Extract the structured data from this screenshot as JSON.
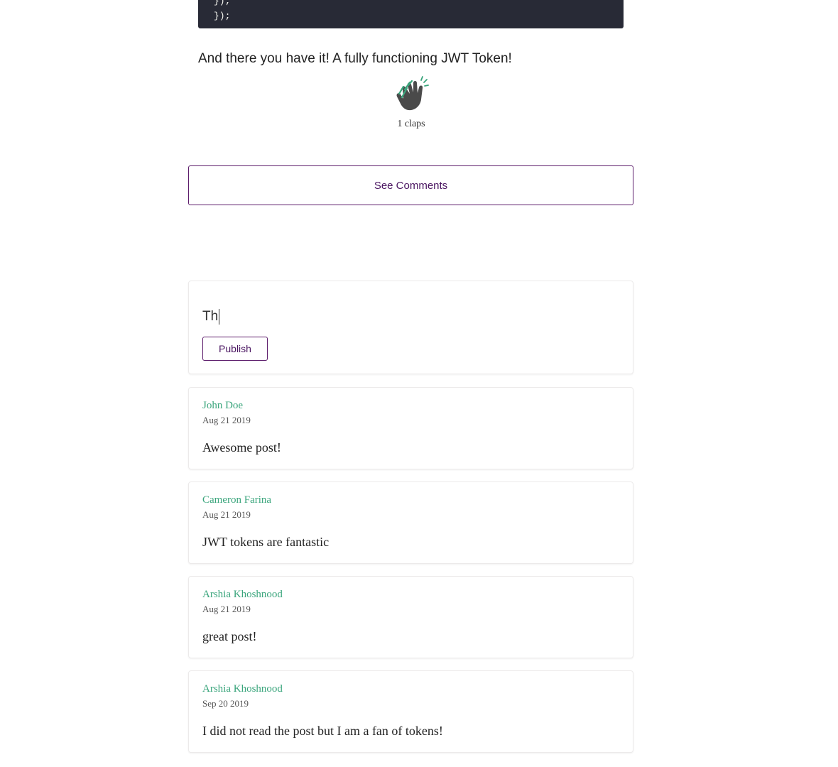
{
  "code": {
    "line1": "});",
    "line2": "});"
  },
  "article": {
    "outro": "And there you have it! A fully functioning JWT Token!"
  },
  "claps": {
    "icon": "clap-icon",
    "count_label": "1 claps",
    "colors": {
      "hand": "#4a4a4a",
      "accent": "#3aa57c"
    }
  },
  "see_comments": {
    "label": "See Comments"
  },
  "composer": {
    "value": "Th",
    "publish_label": "Publish"
  },
  "comments": [
    {
      "author": "John Doe",
      "date": "Aug 21 2019",
      "body": "Awesome post!"
    },
    {
      "author": "Cameron Farina",
      "date": "Aug 21 2019",
      "body": "JWT tokens are fantastic"
    },
    {
      "author": "Arshia Khoshnood",
      "date": "Aug 21 2019",
      "body": "great post!"
    },
    {
      "author": "Arshia Khoshnood",
      "date": "Sep 20 2019",
      "body": "I did not read the post but I am a fan of tokens!"
    }
  ],
  "theme": {
    "accent_purple": "#5c1c6b",
    "author_green": "#3aa57c",
    "code_bg": "#282a36"
  }
}
